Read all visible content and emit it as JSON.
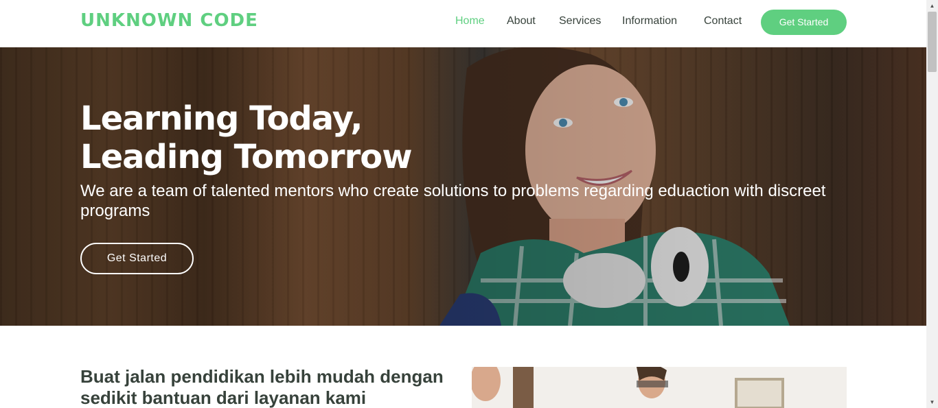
{
  "header": {
    "logo": "UNKNOWN CODE",
    "nav": {
      "home": "Home",
      "about": "About",
      "services": "Services",
      "information": "Information",
      "contact": "Contact"
    },
    "cta_label": "Get Started"
  },
  "hero": {
    "title_line1": "Learning Today,",
    "title_line2": "Leading Tomorrow",
    "subtitle": "We are a team of talented mentors who create solutions to problems regarding eduaction with discreet programs",
    "button_label": "Get Started"
  },
  "about": {
    "heading": "Buat jalan pendidikan lebih mudah dengan sedikit bantuan dari layanan kami"
  },
  "colors": {
    "accent": "#5fcf80",
    "text_dark": "#37423b"
  },
  "icons": {
    "scroll_up": "triangle-up-icon",
    "scroll_down": "triangle-down-icon"
  }
}
